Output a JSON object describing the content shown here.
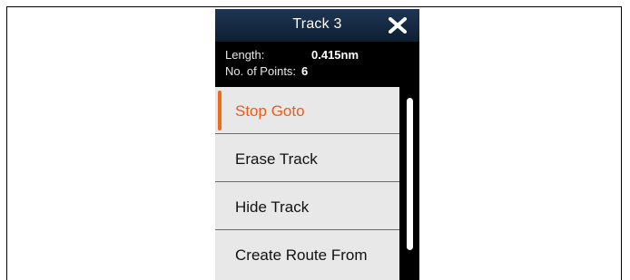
{
  "dialog": {
    "title": "Track 3",
    "close_icon": "close-x-icon"
  },
  "info": {
    "length_label": "Length:",
    "length_value": "0.415nm",
    "points_label": "No. of Points:",
    "points_value": "6"
  },
  "menu": {
    "items": [
      {
        "label": "Stop Goto",
        "active": true
      },
      {
        "label": "Erase Track",
        "active": false
      },
      {
        "label": "Hide Track",
        "active": false
      },
      {
        "label": "Create Route From",
        "active": false
      }
    ]
  },
  "colors": {
    "title_bar": "#0d1e31",
    "accent": "#f05a14",
    "menu_bg": "#e8e8e8"
  }
}
